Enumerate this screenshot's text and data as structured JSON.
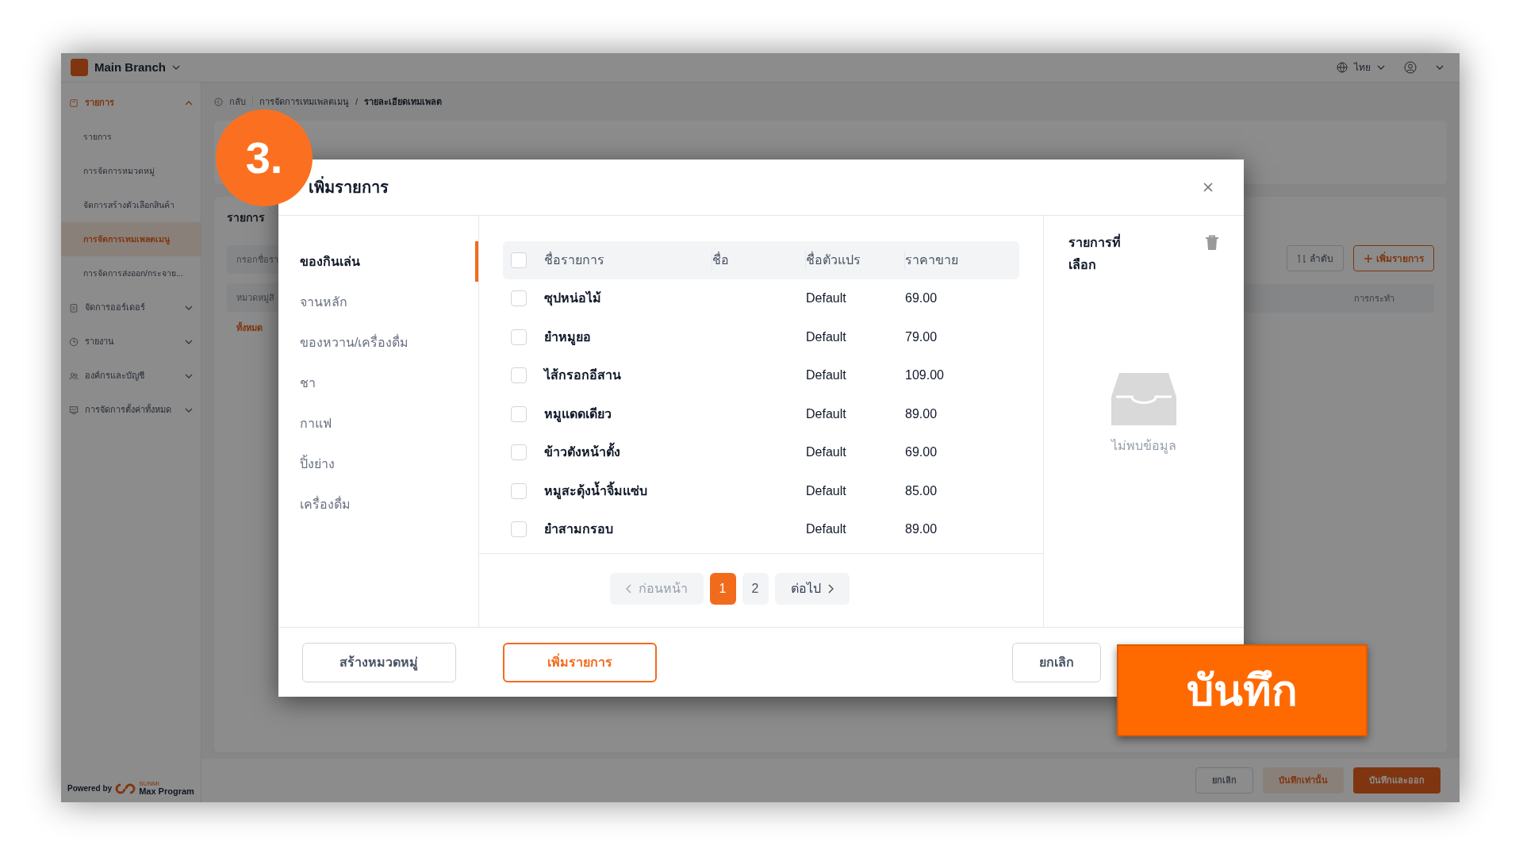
{
  "app": {
    "branch": "Main Branch",
    "language": "ไทย",
    "sidebar": [
      {
        "label": "รายการ",
        "expanded": true,
        "children": [
          {
            "label": "รายการ",
            "selected": false
          },
          {
            "label": "การจัดการหมวดหมู่",
            "selected": false
          },
          {
            "label": "จัดการสร้างตัวเลือกสินค้า",
            "selected": false
          },
          {
            "label": "การจัดการเทมเพลตเมนู",
            "selected": true
          },
          {
            "label": "การจัดการส่งออก/กระจาย...",
            "selected": false
          }
        ]
      },
      {
        "label": "จัดการออร์เดอร์",
        "expanded": false
      },
      {
        "label": "รายงาน",
        "expanded": false
      },
      {
        "label": "องค์กรและบัญชี",
        "expanded": false
      },
      {
        "label": "การจัดการตั้งค่าทั้งหมด",
        "expanded": false
      }
    ],
    "powered_by": "Powered by",
    "brand_small": "SUNMI",
    "brand": "Max Program",
    "breadcrumb": {
      "back": "กลับ",
      "separator": "/",
      "items": [
        "การจัดการเทมเพลตเมนู",
        "รายละเอียดเทมเพลต"
      ]
    },
    "panel": {
      "title": "รายการ",
      "search_placeholder": "กรอกชื่อรา",
      "category_placeholder": "หมวดหมู่สิ",
      "filter": "ทั้งหมด",
      "sort": "ลำดับ",
      "add": "เพิ่มรายการ",
      "column": "การกระทำ"
    },
    "footer_buttons": [
      {
        "label": "ยกเลิก",
        "kind": "outline"
      },
      {
        "label": "บันทึกเท่านั้น",
        "kind": "soft"
      },
      {
        "label": "บันทึกและออก",
        "kind": "primary"
      }
    ]
  },
  "modal": {
    "title": "เพิ่มรายการ",
    "categories": [
      {
        "label": "ของกินเล่น",
        "selected": true
      },
      {
        "label": "จานหลัก",
        "selected": false
      },
      {
        "label": "ของหวาน/เครื่องดื่ม",
        "selected": false
      },
      {
        "label": "ชา",
        "selected": false
      },
      {
        "label": "กาแฟ",
        "selected": false
      },
      {
        "label": "ปิ้งย่าง",
        "selected": false
      },
      {
        "label": "เครื่องดื่ม",
        "selected": false
      }
    ],
    "select_all_checked": false,
    "columns": [
      "ชื่อรายการ",
      "ชื่อ",
      "ชื่อตัวแปร",
      "ราคาขาย"
    ],
    "rows": [
      {
        "name": "ซุปหน่อไม้",
        "variant": "Default",
        "price": "69.00",
        "checked": false
      },
      {
        "name": "ยำหมูยอ",
        "variant": "Default",
        "price": "79.00",
        "checked": false
      },
      {
        "name": "ไส้กรอกอีสาน",
        "variant": "Default",
        "price": "109.00",
        "checked": false
      },
      {
        "name": "หมูแดดเดียว",
        "variant": "Default",
        "price": "89.00",
        "checked": false
      },
      {
        "name": "ข้าวตังหน้าตั้ง",
        "variant": "Default",
        "price": "69.00",
        "checked": false
      },
      {
        "name": "หมูสะดุ้งน้ำจิ้มแซ่บ",
        "variant": "Default",
        "price": "85.00",
        "checked": false
      },
      {
        "name": "ยำสามกรอบ",
        "variant": "Default",
        "price": "89.00",
        "checked": false
      }
    ],
    "pagination": {
      "prev": "ก่อนหน้า",
      "pages": [
        {
          "label": "1",
          "selected": true
        },
        {
          "label": "2",
          "selected": false
        }
      ],
      "next": "ต่อไป"
    },
    "selected_panel": {
      "title": "รายการที่เลือก",
      "empty": "ไม่พบข้อมูล"
    },
    "buttons": {
      "create_category": "สร้างหมวดหมู่",
      "add_item": "เพิ่มรายการ",
      "cancel": "ยกเลิก"
    }
  },
  "annotations": {
    "step": "3.",
    "callout": "บันทึก"
  }
}
